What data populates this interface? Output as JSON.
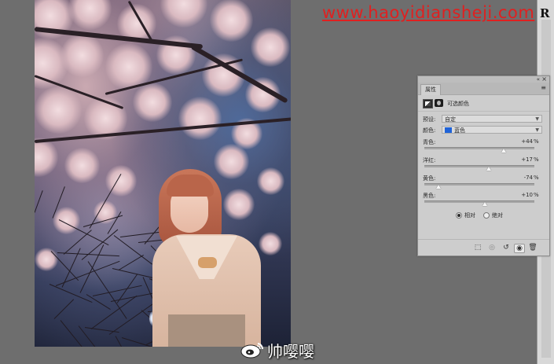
{
  "watermark": {
    "site_url": "www.haoyidiansheji.com",
    "corner_letter": "R"
  },
  "weibo": {
    "username": "帅嘤嘤"
  },
  "properties_panel": {
    "tab_label": "属性",
    "collapse_glyph": "«",
    "close_glyph": "×",
    "menu_glyph": "≡",
    "adjustment_title": "可选颜色",
    "preset": {
      "label": "预设:",
      "value": "自定"
    },
    "colors": {
      "label": "颜色:",
      "value": "蓝色",
      "swatch_color": "#1f63d8"
    },
    "sliders": [
      {
        "label": "青色:",
        "value": "+44",
        "unit": "%",
        "level": 0.72
      },
      {
        "label": "洋红:",
        "value": "+17",
        "unit": "%",
        "level": 0.585
      },
      {
        "label": "黄色:",
        "value": "-74",
        "unit": "%",
        "level": 0.13
      },
      {
        "label": "黑色:",
        "value": "+10",
        "unit": "%",
        "level": 0.55
      }
    ],
    "method": {
      "relative_label": "相对",
      "absolute_label": "绝对",
      "selected": "relative"
    },
    "bottom_icons": [
      "clip-to-layer-icon",
      "view-previous-icon",
      "reset-icon",
      "visibility-eye-icon",
      "trash-icon"
    ]
  }
}
